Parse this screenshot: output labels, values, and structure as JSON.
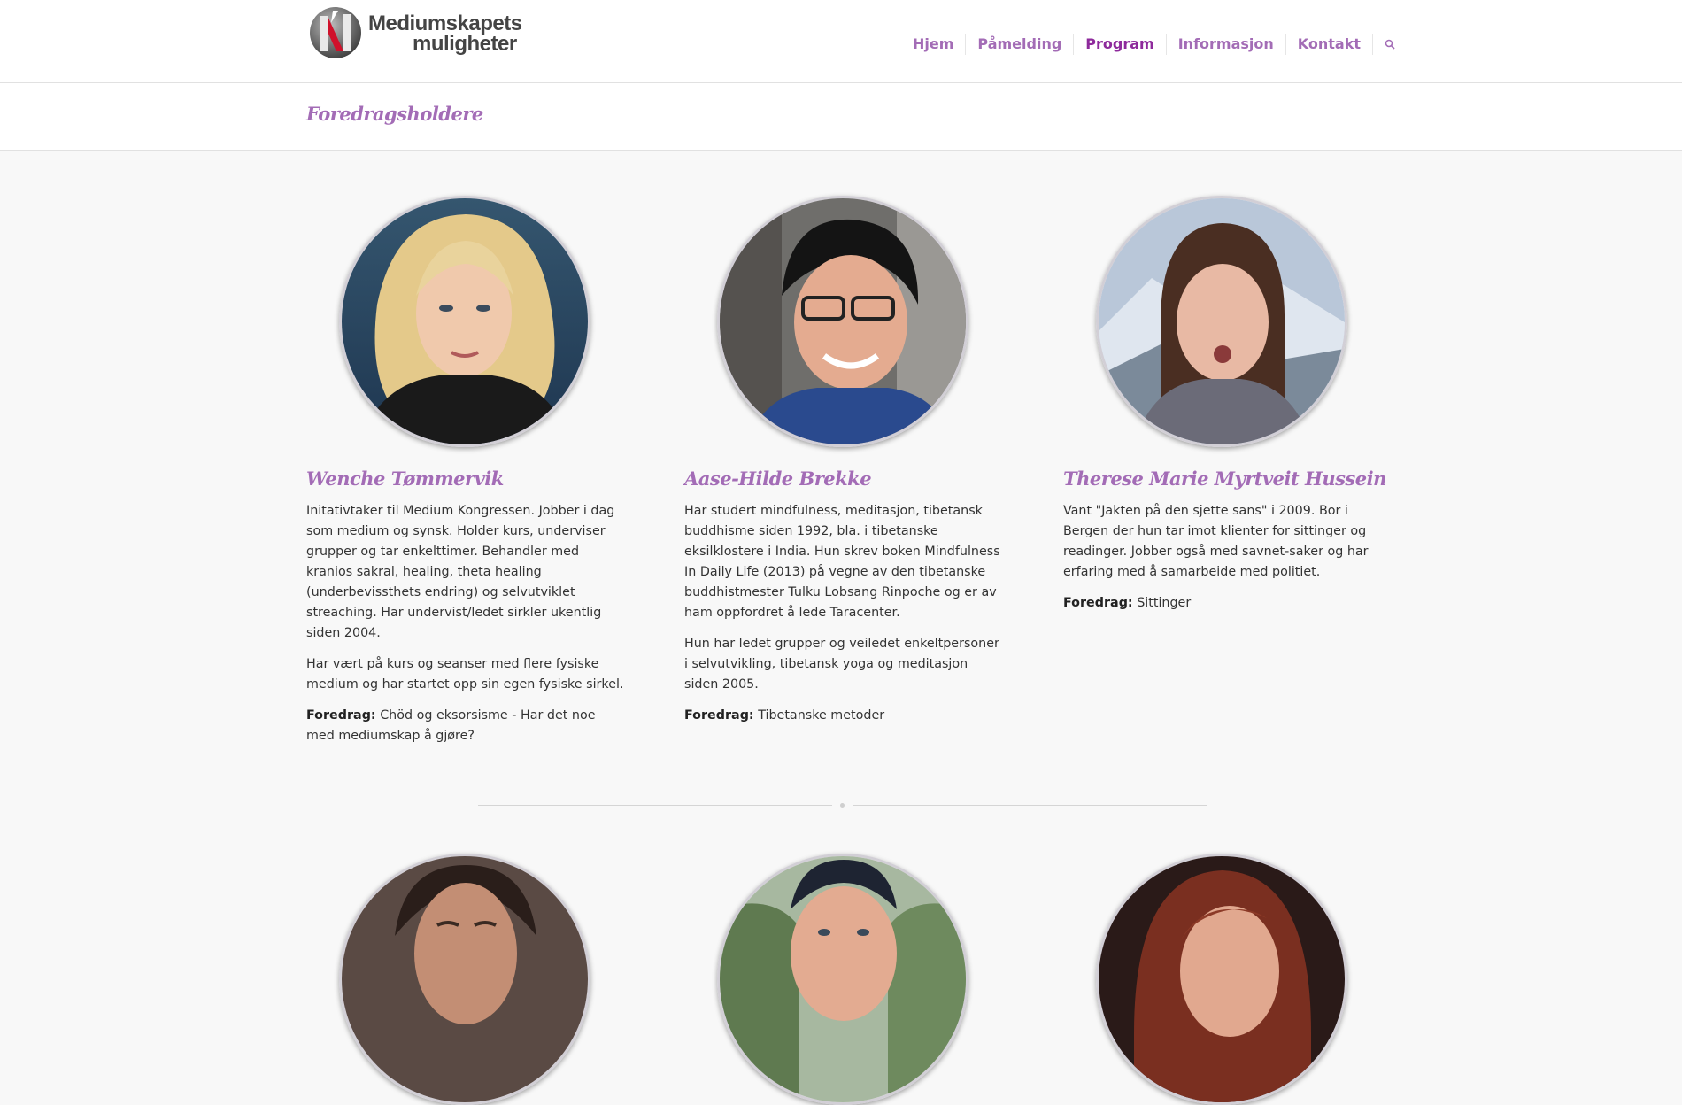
{
  "logo": {
    "line1": "Mediumskapets",
    "line2": "muligheter"
  },
  "nav": {
    "items": [
      {
        "label": "Hjem"
      },
      {
        "label": "Påmelding"
      },
      {
        "label": "Program"
      },
      {
        "label": "Informasjon"
      },
      {
        "label": "Kontakt"
      }
    ],
    "active": "Program",
    "search_icon": "search-icon"
  },
  "page": {
    "title": "Foredragsholdere"
  },
  "speakers": [
    {
      "name": "Wenche Tømmervik",
      "bio": [
        "Initativtaker til Medium Kongressen. Jobber i dag som medium og synsk. Holder kurs, underviser grupper og tar enkelttimer. Behandler med kranios sakral, healing, theta healing (underbevissthets endring) og selvutviklet streaching. Har undervist/ledet sirkler ukentlig siden 2004.",
        "Har vært på kurs og seanser med flere fysiske medium og har startet opp sin egen fysiske sirkel."
      ],
      "talk_label": "Foredrag:",
      "talk": "Chöd og eksorsisme - Har det noe med mediumskap å gjøre?"
    },
    {
      "name": "Aase-Hilde Brekke",
      "bio": [
        "Har studert mindfulness, meditasjon, tibetansk buddhisme siden 1992, bla. i tibetanske eksilklostere i India. Hun skrev boken Mindfulness In Daily Life (2013) på vegne av den tibetanske buddhistmester Tulku Lobsang Rinpoche og er av ham oppfordret å lede Taracenter.",
        "Hun har ledet grupper og veiledet enkeltpersoner i selvutvikling, tibetansk yoga og meditasjon siden 2005."
      ],
      "talk_label": "Foredrag:",
      "talk": "Tibetanske metoder"
    },
    {
      "name": "Therese Marie Myrtveit Hussein",
      "bio": [
        "Vant \"Jakten på den sjette sans\" i 2009. Bor i Bergen der hun tar imot klienter for sittinger og readinger. Jobber også med savnet-saker og har erfaring med å samarbeide med politiet."
      ],
      "talk_label": "Foredrag:",
      "talk": "Sittinger"
    }
  ],
  "colors": {
    "accent": "#a36cb6",
    "active_nav": "#8e2a9c",
    "background": "#f8f8f8"
  }
}
